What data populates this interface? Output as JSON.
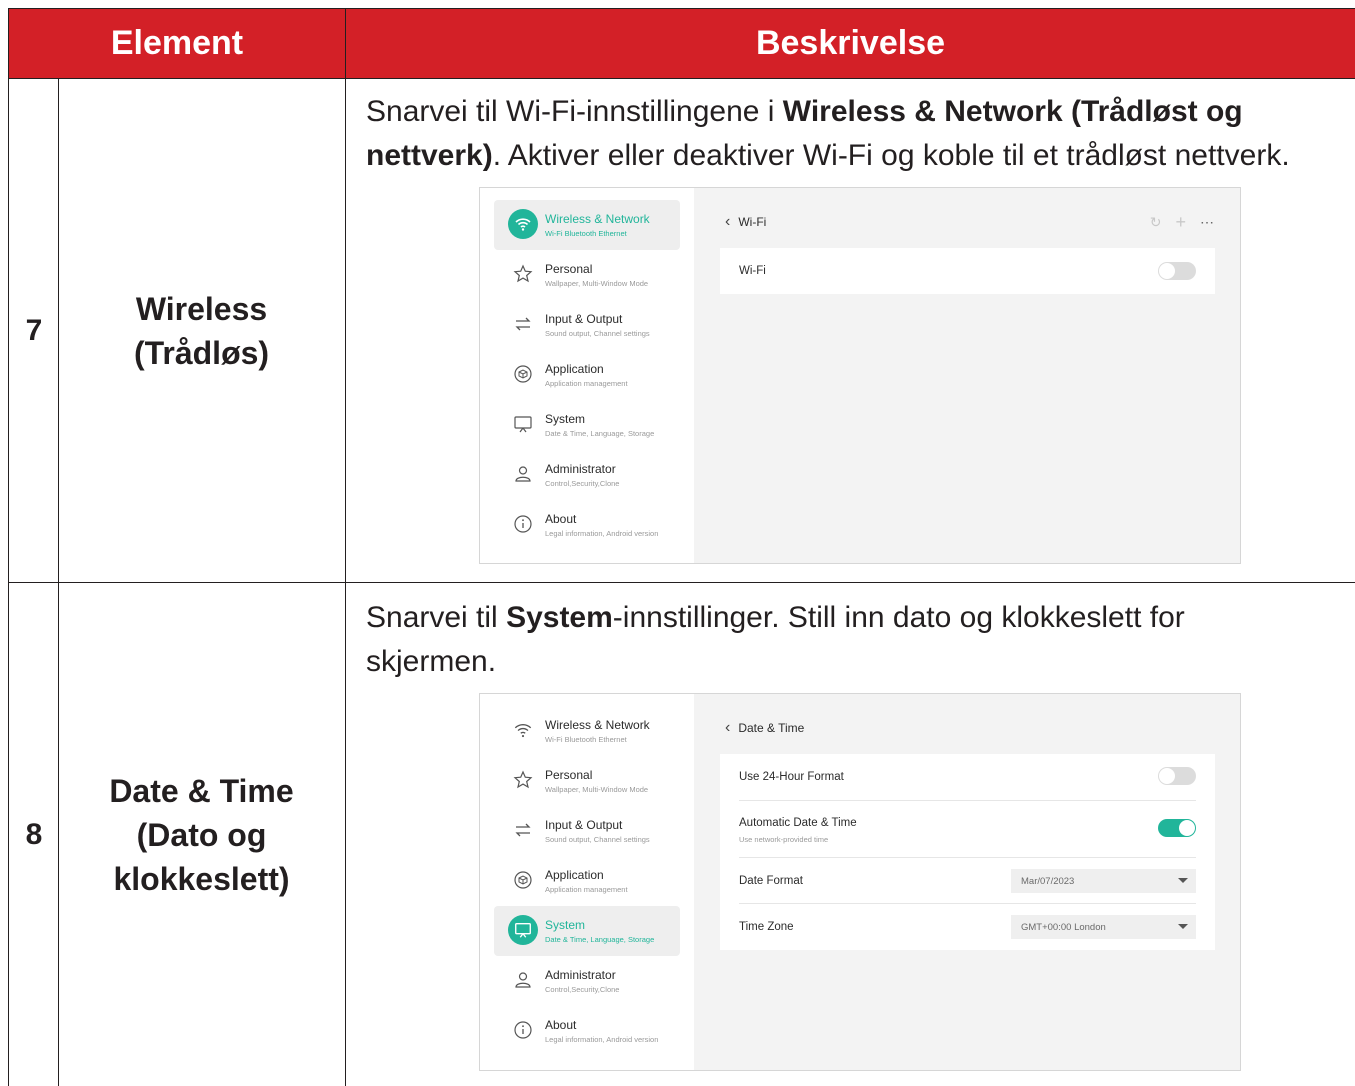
{
  "table": {
    "col_element": "Element",
    "col_desc": "Beskrivelse",
    "header_color": "#d32027"
  },
  "rows": [
    {
      "num": "7",
      "element_line1": "Wireless",
      "element_line2": "(Trådløs)",
      "desc": {
        "p1": "Snarvei til Wi-Fi-innstillingene i ",
        "b1": "Wireless & Network (Trådløst og nettverk)",
        "p2": ". Aktiver eller deaktiver Wi-Fi og koble til et trådløst nettverk."
      }
    },
    {
      "num": "8",
      "element_line1": "Date & Time",
      "element_line2": "(Dato og",
      "element_line3": "klokkeslett)",
      "desc": {
        "p1": "Snarvei til ",
        "b1": "System",
        "p2": "-innstillinger. Still inn dato og klokkeslett for skjermen."
      }
    }
  ],
  "sidebar": [
    {
      "label": "Wireless & Network",
      "sub": "Wi-Fi Bluetooth Ethernet",
      "icon": "wifi-icon"
    },
    {
      "label": "Personal",
      "sub": "Wallpaper, Multi-Window Mode",
      "icon": "star-icon"
    },
    {
      "label": "Input & Output",
      "sub": "Sound output, Channel settings",
      "icon": "swap-icon"
    },
    {
      "label": "Application",
      "sub": "Application management",
      "icon": "box-icon"
    },
    {
      "label": "System",
      "sub": "Date & Time, Language, Storage",
      "icon": "monitor-icon"
    },
    {
      "label": "Administrator",
      "sub": "Control,Security,Clone",
      "icon": "user-icon"
    },
    {
      "label": "About",
      "sub": "Legal information, Android version",
      "icon": "info-icon"
    }
  ],
  "wifi_panel": {
    "title": "Wi-Fi",
    "row_label": "Wi-Fi",
    "toggle_on": false
  },
  "datetime_panel": {
    "title": "Date & Time",
    "use24": "Use 24-Hour Format",
    "use24_on": false,
    "auto": "Automatic Date & Time",
    "auto_sub": "Use network-provided time",
    "auto_on": true,
    "date_format_label": "Date Format",
    "date_format_value": "Mar/07/2023",
    "time_zone_label": "Time Zone",
    "time_zone_value": "GMT+00:00 London"
  },
  "accent_color": "#21b59a"
}
